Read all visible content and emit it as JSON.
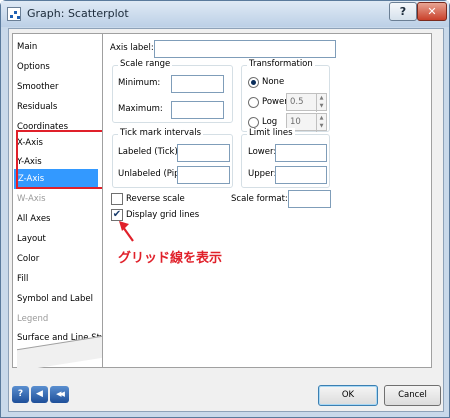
{
  "window": {
    "title": "Graph: Scatterplot",
    "help_glyph": "?",
    "close_glyph": "✕"
  },
  "sidebar": {
    "items": [
      {
        "label": "Main",
        "state": "normal"
      },
      {
        "label": "Options",
        "state": "normal"
      },
      {
        "label": "Smoother",
        "state": "normal"
      },
      {
        "label": "Residuals",
        "state": "normal"
      },
      {
        "label": "Coordinates",
        "state": "normal"
      },
      {
        "label": "X-Axis",
        "state": "normal"
      },
      {
        "label": "Y-Axis",
        "state": "normal"
      },
      {
        "label": "Z-Axis",
        "state": "selected"
      },
      {
        "label": "W-Axis",
        "state": "disabled"
      },
      {
        "label": "All Axes",
        "state": "normal"
      },
      {
        "label": "Layout",
        "state": "normal"
      },
      {
        "label": "Color",
        "state": "normal"
      },
      {
        "label": "Fill",
        "state": "normal"
      },
      {
        "label": "Symbol and Label",
        "state": "normal"
      },
      {
        "label": "Legend",
        "state": "disabled"
      },
      {
        "label": "Surface and Line Style",
        "state": "normal"
      }
    ]
  },
  "panel": {
    "axis_label": {
      "label": "Axis label:",
      "value": ""
    },
    "scale_range": {
      "title": "Scale range",
      "minimum_label": "Minimum:",
      "minimum_value": "",
      "maximum_label": "Maximum:",
      "maximum_value": ""
    },
    "transformation": {
      "title": "Transformation",
      "none_label": "None",
      "power_label": "Power",
      "power_value": "0.5",
      "log_label": "Log",
      "log_value": "10",
      "selected": "None"
    },
    "tick_marks": {
      "title": "Tick mark intervals",
      "labeled_label": "Labeled (Tick):",
      "labeled_value": "",
      "unlabeled_label": "Unlabeled (Pip):",
      "unlabeled_value": ""
    },
    "limit_lines": {
      "title": "Limit lines",
      "lower_label": "Lower:",
      "lower_value": "",
      "upper_label": "Upper:",
      "upper_value": ""
    },
    "reverse_scale": {
      "label": "Reverse scale",
      "checked": false
    },
    "scale_format": {
      "label": "Scale format:",
      "value": ""
    },
    "display_grid_lines": {
      "label": "Display grid lines",
      "checked": true,
      "check_glyph": "✔"
    }
  },
  "annotation": {
    "text": "グリッド線を表示",
    "color": "#e0202a"
  },
  "footer": {
    "help_glyph": "?",
    "back_glyph": "◀",
    "first_glyph": "◀◀",
    "ok_label": "OK",
    "cancel_label": "Cancel"
  },
  "colors": {
    "selection": "#3399ff",
    "highlight": "#e0202a"
  }
}
